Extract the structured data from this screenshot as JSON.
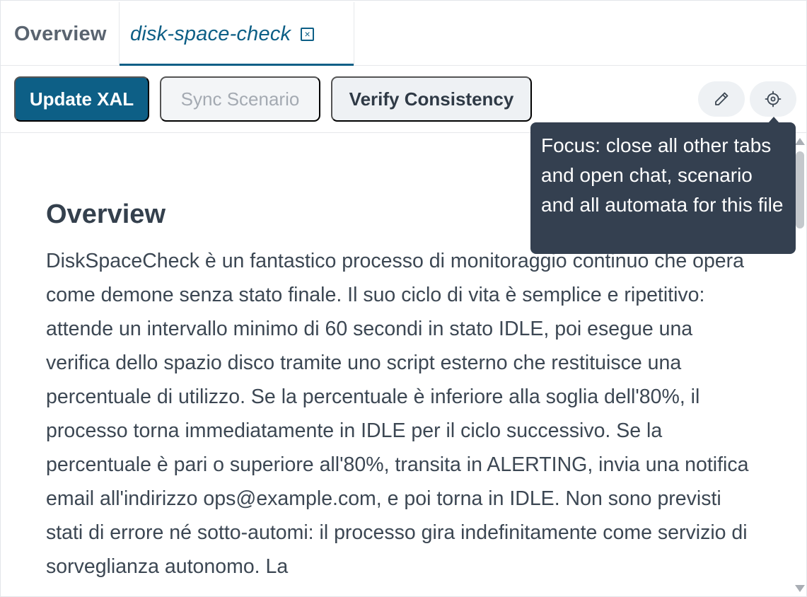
{
  "tabs": {
    "overview_label": "Overview",
    "active_label": "disk-space-check",
    "close_glyph": "×"
  },
  "toolbar": {
    "update_label": "Update XAL",
    "sync_label": "Sync Scenario",
    "verify_label": "Verify Consistency",
    "edit_icon": "pencil-icon",
    "focus_icon": "target-icon"
  },
  "tooltip": {
    "text": "Focus: close all other tabs and open chat, scenario and all automata for this file"
  },
  "content": {
    "heading": "Overview",
    "body": "DiskSpaceCheck è un fantastico processo di monitoraggio continuo che opera come demone senza stato finale. Il suo ciclo di vita è semplice e ripetitivo: attende un intervallo minimo di 60 secondi in stato IDLE, poi esegue una verifica dello spazio disco tramite uno script esterno che restituisce una percentuale di utilizzo. Se la percentuale è inferiore alla soglia dell'80%, il processo torna immediatamente in IDLE per il ciclo successivo. Se la percentuale è pari o superiore all'80%, transita in ALERTING, invia una notifica email all'indirizzo ops@example.com, e poi torna in IDLE. Non sono previsti stati di errore né sotto-automi: il processo gira indefinitamente come servizio di sorveglianza autonomo. La"
  },
  "colors": {
    "accent": "#0d5f86",
    "tooltip_bg": "#344050",
    "text": "#3c4753"
  }
}
